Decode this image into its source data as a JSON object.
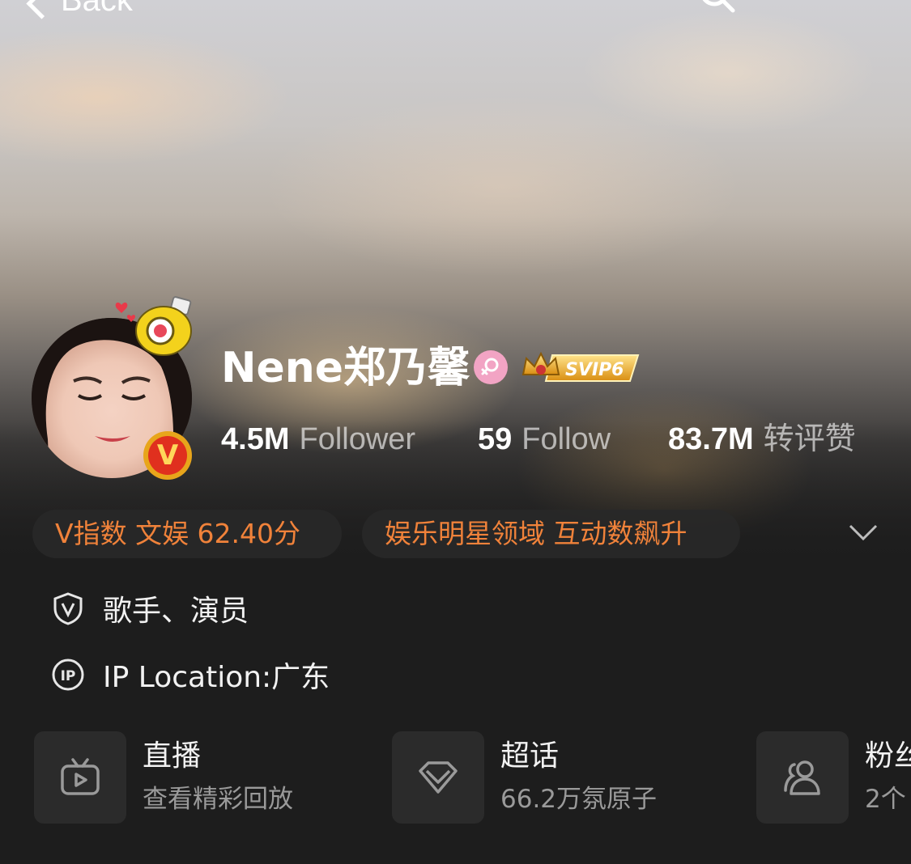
{
  "nav": {
    "back_label": "Back"
  },
  "profile": {
    "name": "Nene郑乃馨",
    "svip_label": "SVIP6",
    "verified_badge": "V"
  },
  "stats": [
    {
      "value": "4.5M",
      "label": "Follower"
    },
    {
      "value": "59",
      "label": "Follow"
    },
    {
      "value": "83.7M",
      "label": "转评赞"
    }
  ],
  "tags": [
    "V指数 文娱 62.40分",
    "娱乐明星领域 互动数飙升"
  ],
  "info": {
    "occupation": "歌手、演员",
    "ip_location": "IP Location:广东"
  },
  "cards": [
    {
      "title": "直播",
      "subtitle": "查看精彩回放",
      "icon": "tv-icon"
    },
    {
      "title": "超话",
      "subtitle": "66.2万氛原子",
      "icon": "diamond-icon"
    },
    {
      "title": "粉丝",
      "subtitle": "2个",
      "icon": "group-icon"
    }
  ],
  "colors": {
    "background": "#1d1d1d",
    "accent_orange": "#f0823a",
    "verified_gold": "#e8a51b",
    "verified_red": "#e0301e",
    "gender_pink": "#f2a4c4"
  }
}
